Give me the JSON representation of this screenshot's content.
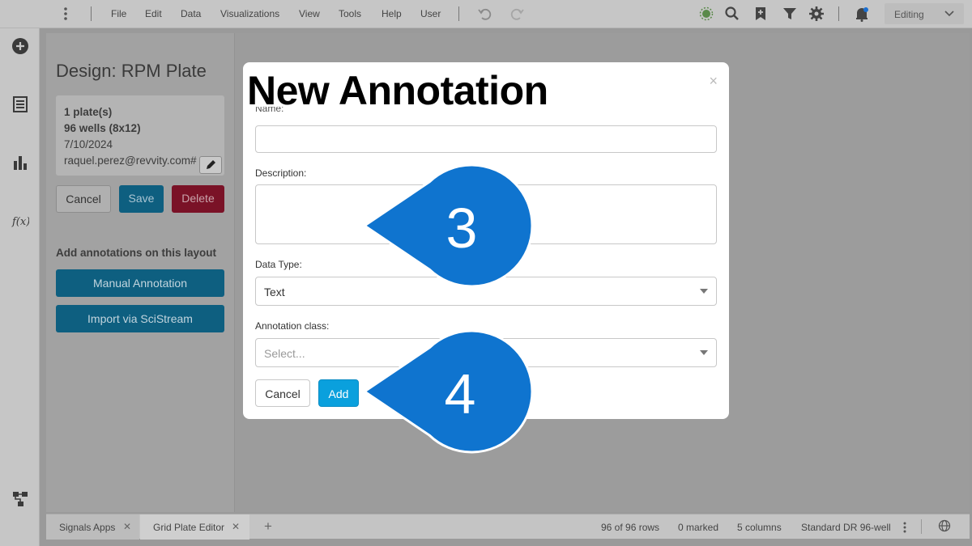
{
  "menu": {
    "items": [
      "File",
      "Edit",
      "Data",
      "Visualizations",
      "View",
      "Tools",
      "Help",
      "User"
    ],
    "mode": "Editing"
  },
  "left_panel": {
    "title": "Design: RPM Plate",
    "info": {
      "plates": "1 plate(s)",
      "wells": "96 wells (8x12)",
      "date": "7/10/2024",
      "email": "raquel.perez@revvity.com#"
    },
    "cancel_label": "Cancel",
    "save_label": "Save",
    "delete_label": "Delete",
    "annotations_heading": "Add annotations on this layout",
    "manual_label": "Manual Annotation",
    "import_label": "Import via SciStream"
  },
  "modal": {
    "title": "New Annotation",
    "close": "×",
    "name_label": "Name:",
    "name_value": "",
    "description_label": "Description:",
    "description_value": "",
    "data_type_label": "Data Type:",
    "data_type_value": "Text",
    "annotation_class_label": "Annotation class:",
    "annotation_class_placeholder": "Select...",
    "cancel_label": "Cancel",
    "add_label": "Add"
  },
  "callouts": {
    "step_a": "3",
    "step_b": "4",
    "color": "#0f74cf"
  },
  "bottom_bar": {
    "tabs": [
      "Signals Apps",
      "Grid Plate Editor"
    ],
    "add_tab": "+",
    "rows": "96 of 96 rows",
    "marked": "0 marked",
    "columns": "5 columns",
    "layout": "Standard DR 96-well"
  },
  "colors": {
    "accent": "#0aa0dd",
    "save": "#0e5f80",
    "delete": "#7a1227"
  }
}
